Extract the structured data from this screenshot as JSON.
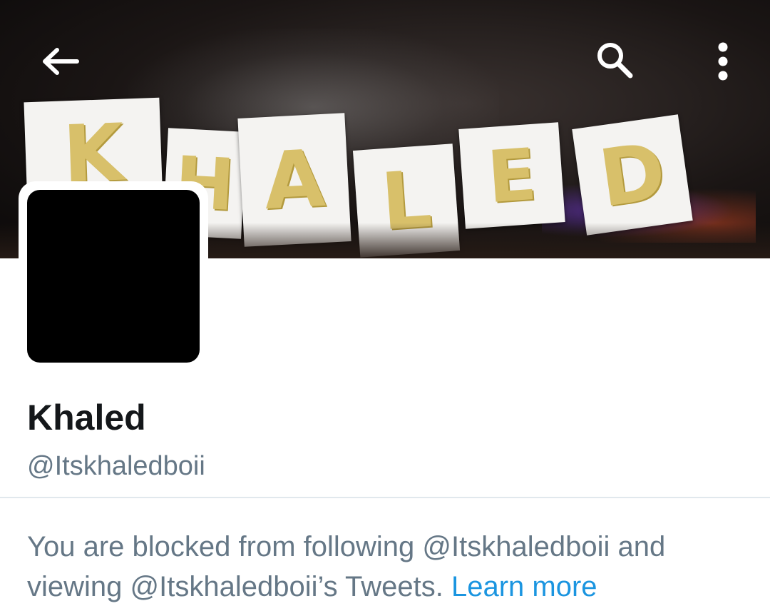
{
  "header": {
    "banner_image": "Khaled party banner",
    "banner_letters": [
      "K",
      "H",
      "A",
      "L",
      "E",
      "D"
    ],
    "back_icon": "arrow-left-icon",
    "search_icon": "search-icon",
    "menu_icon": "more-vertical-icon"
  },
  "profile": {
    "name": "Khaled",
    "handle": "@Itskhaledboii"
  },
  "blocked": {
    "message": "You are blocked from following @Itskhaledboii and viewing @Itskhaledboii’s Tweets.",
    "learn_more": "Learn more"
  },
  "colors": {
    "text_primary": "#14171a",
    "text_secondary": "#657786",
    "link": "#1b95e0",
    "divider": "#e1e8ed"
  }
}
